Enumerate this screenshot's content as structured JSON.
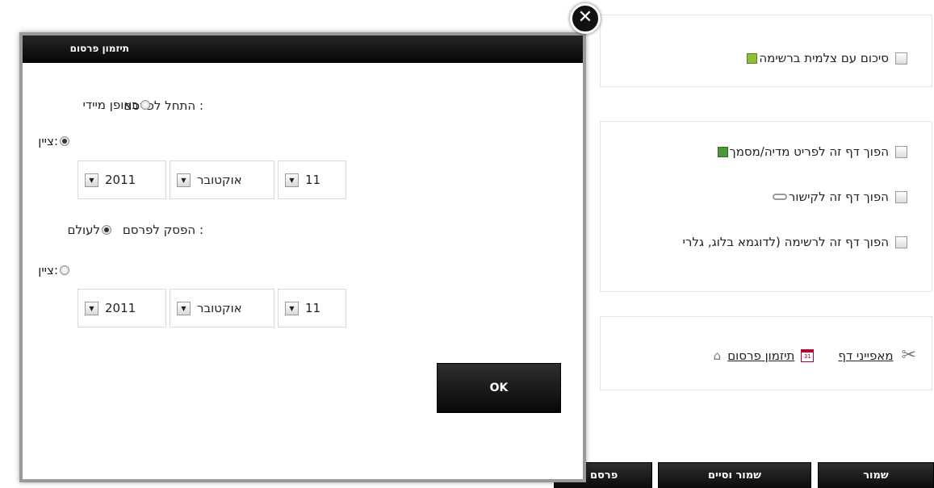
{
  "background": {
    "summary_checkbox_label": "סיכום עם צלמית ברשימה",
    "convert_media_label": "הפוך דף זה לפריט מדיה/מסמך",
    "convert_link_label": "הפוך דף זה לקישור",
    "convert_list_label": "הפוך דף זה לרשימה (לדוגמא בלוג, גלרי",
    "page_properties_link": "מאפייני דף",
    "schedule_link": "תיזמון פרסום",
    "calendar_icon_text": "31",
    "buttons": {
      "save": "שמור",
      "save_exit": "שמור וסיים",
      "publish": "פרסם"
    }
  },
  "modal": {
    "title": "תיזמון פרסום",
    "close_symbol": "✕",
    "start_label": "התחל לפרסם :",
    "stop_label": "הפסק לפרסם :",
    "start_options": {
      "immediate": "באופן מיידי",
      "set": "ציין:",
      "selected": "set"
    },
    "start_date": {
      "day": "11",
      "month": "אוקטובר",
      "year": "2011"
    },
    "stop_options": {
      "forever": "לעולם",
      "set": "ציין:",
      "selected": "forever"
    },
    "stop_date": {
      "day": "11",
      "month": "אוקטובר",
      "year": "2011"
    },
    "dropdown_symbol": "▼",
    "ok_label": "OK"
  }
}
